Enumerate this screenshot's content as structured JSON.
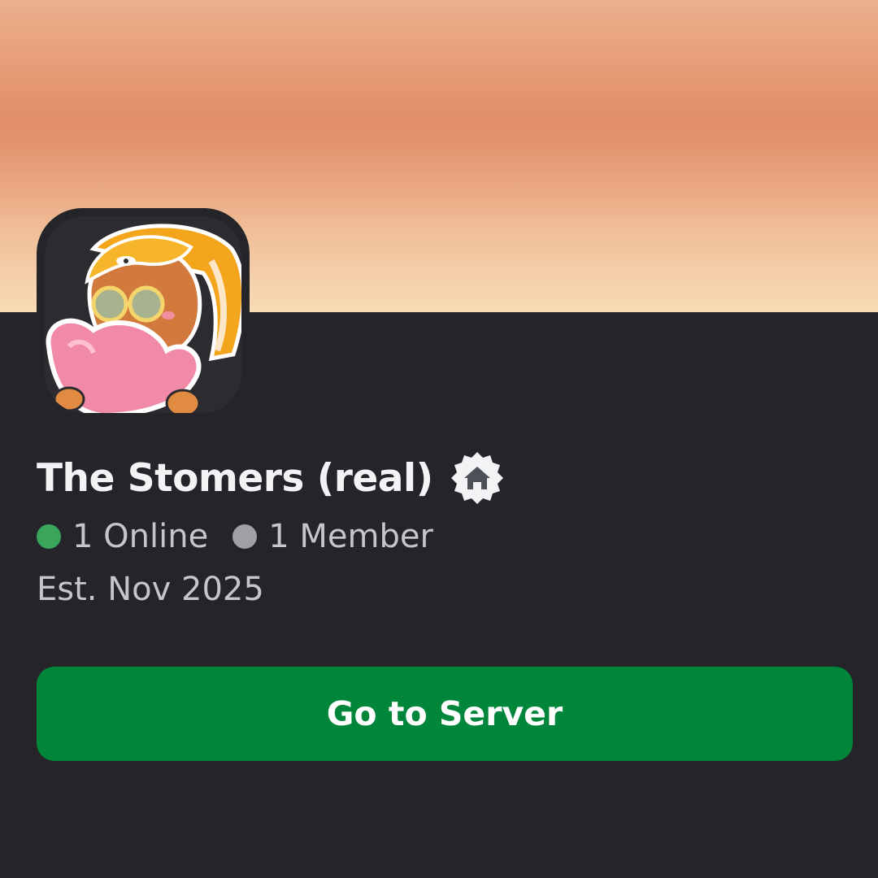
{
  "banner": {
    "gradient_colors": [
      "#eab08c",
      "#e08e68",
      "#f8dcb4"
    ]
  },
  "server": {
    "name": "The Stomers (real)",
    "badge_icon": "home-badge-icon",
    "online_count_text": "1 Online",
    "member_count_text": "1 Member",
    "established_text": "Est. Nov 2025",
    "avatar_icon": "server-avatar"
  },
  "status_colors": {
    "online": "#3ba55c",
    "member": "#9ea0a6"
  },
  "action": {
    "go_to_server_label": "Go to Server",
    "color": "#00863a"
  }
}
